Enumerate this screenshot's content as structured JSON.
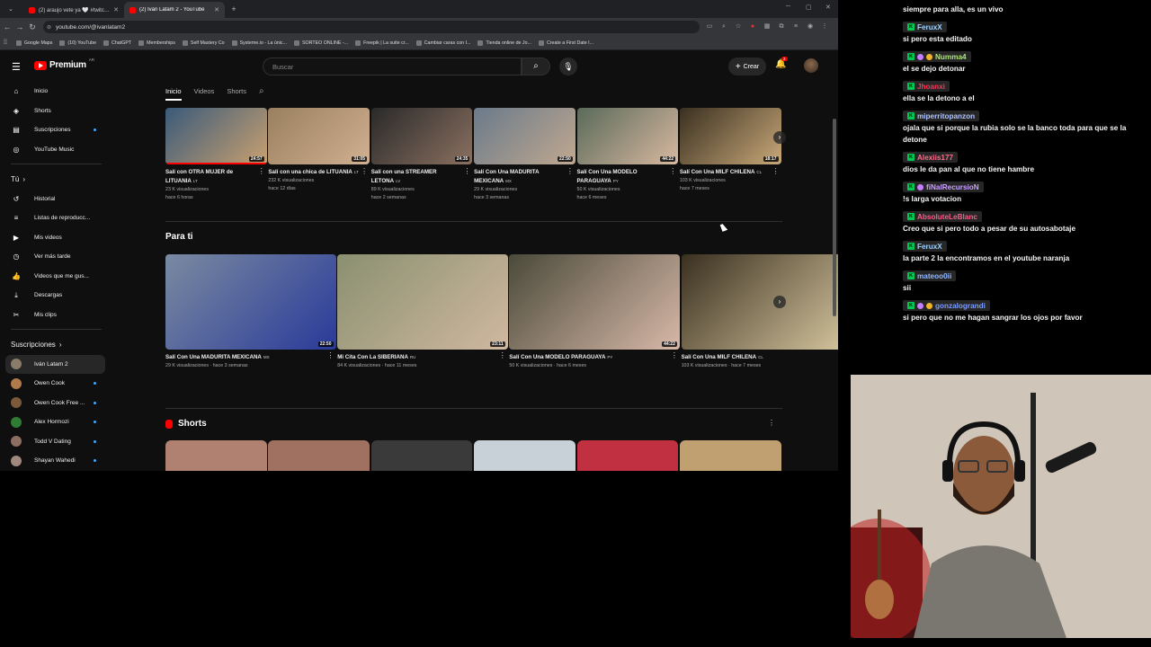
{
  "browser": {
    "tabs": [
      {
        "label": "(2) araujo vete ya 🤍 #twitch 🤍 "
      },
      {
        "label": "(2) Iván Latam 2 - YouTube"
      }
    ],
    "url": "youtube.com/@ivanlatam2",
    "bookmarks": [
      "Google Maps",
      "(10) YouTube",
      "ChatGPT",
      "Memberships",
      "Self Mastery Co",
      "Systeme.io - La únic...",
      "SORTEO ONLINE -...",
      "Freepik | La suite cr...",
      "Cambiar caras con I...",
      "Tienda online de Jo...",
      "Create a First Date I..."
    ]
  },
  "header": {
    "logo": "Premium",
    "region": "AR",
    "search_placeholder": "Buscar",
    "create_label": "Crear",
    "notifications": "2"
  },
  "sidebar": {
    "main": [
      {
        "label": "Inicio",
        "icon": "home-icon"
      },
      {
        "label": "Shorts",
        "icon": "shorts-icon"
      },
      {
        "label": "Suscripciones",
        "icon": "subscriptions-icon"
      },
      {
        "label": "YouTube Music",
        "icon": "music-icon"
      }
    ],
    "you_header": "Tú",
    "you": [
      {
        "label": "Historial",
        "icon": "history-icon"
      },
      {
        "label": "Listas de reproducc...",
        "icon": "playlist-icon"
      },
      {
        "label": "Mis videos",
        "icon": "video-icon"
      },
      {
        "label": "Ver más tarde",
        "icon": "clock-icon"
      },
      {
        "label": "Videos que me gus...",
        "icon": "like-icon"
      },
      {
        "label": "Descargas",
        "icon": "download-icon"
      },
      {
        "label": "Mis clips",
        "icon": "scissors-icon"
      }
    ],
    "subs_header": "Suscripciones",
    "subs": [
      {
        "label": "Iván Latam 2",
        "color": "#8a7b6a"
      },
      {
        "label": "Owen Cook",
        "color": "#b07a4a"
      },
      {
        "label": "Owen Cook Free ...",
        "color": "#7a5a3a"
      },
      {
        "label": "Alex Hormozi",
        "color": "#2e7d32"
      },
      {
        "label": "Todd V Dating",
        "color": "#8d6e63"
      },
      {
        "label": "Shayan Wahedi",
        "color": "#a1887f"
      }
    ]
  },
  "channel_tabs": [
    "Inicio",
    "Videos",
    "Shorts"
  ],
  "row1": [
    {
      "title": "Salí con OTRA MUJER de LITUANIA",
      "flag": "LT",
      "views": "23 K visualizaciones",
      "age": "hace 6 horas",
      "dur": "24:57",
      "c1": "#3a5a7a",
      "c2": "#c8a070"
    },
    {
      "title": "Salí con una chica de LITUANIA",
      "flag": "LT",
      "views": "232 K visualizaciones",
      "age": "hace 12 días",
      "dur": "31:05",
      "c1": "#9a8060",
      "c2": "#d0b090"
    },
    {
      "title": "Salí con una STREAMER LETONA",
      "flag": "LV",
      "views": "89 K visualizaciones",
      "age": "hace 2 semanas",
      "dur": "24:35",
      "c1": "#2a2a2a",
      "c2": "#8a7060"
    },
    {
      "title": "Salí Con Una MADURITA MEXICANA",
      "flag": "MX",
      "views": "29 K visualizaciones",
      "age": "hace 3 semanas",
      "dur": "22:50",
      "c1": "#6a7a8a",
      "c2": "#c0a890"
    },
    {
      "title": "Salí Con Una MODELO PARAGUAYA",
      "flag": "PY",
      "views": "50 K visualizaciones",
      "age": "hace 6 meses",
      "dur": "44:22",
      "c1": "#5a6a5a",
      "c2": "#d8b8a0"
    },
    {
      "title": "Salí Con Una MILF CHILENA",
      "flag": "CL",
      "views": "103 K visualizaciones",
      "age": "hace 7 meses",
      "dur": "18:17",
      "c1": "#3a3020",
      "c2": "#c8a878"
    }
  ],
  "section_para_ti": "Para ti",
  "row2": [
    {
      "title": "Salí Con Una MADURITA MEXICANA",
      "flag": "MX",
      "meta": "29 K visualizaciones · hace 3 semanas",
      "dur": "22:50",
      "c1": "#7a8aa0",
      "c2": "#2a3a9a"
    },
    {
      "title": "Mi Cita Con La SIBERIANA",
      "flag": "RU",
      "meta": "84 K visualizaciones · hace 11 meses",
      "dur": "23:11",
      "c1": "#8a9070",
      "c2": "#d0b8a0"
    },
    {
      "title": "Salí Con Una MODELO PARAGUAYA",
      "flag": "PY",
      "meta": "50 K visualizaciones · hace 6 meses",
      "dur": "44:22",
      "c1": "#4a4a3a",
      "c2": "#d8b8a8"
    },
    {
      "title": "Salí Con Una MILF CHILENA",
      "flag": "CL",
      "meta": "103 K visualizaciones · hace 7 meses",
      "dur": "",
      "c1": "#3a3020",
      "c2": "#d8c8a0"
    }
  ],
  "section_shorts": "Shorts",
  "shorts": [
    {
      "c": "#b08070"
    },
    {
      "c": "#a07060"
    },
    {
      "c": "#3a3a3a"
    },
    {
      "c": "#c8d0d8"
    },
    {
      "c": "#c03040"
    },
    {
      "c": "#c0a070"
    }
  ],
  "chat": [
    {
      "text": "siempre para alla, es un vivo"
    },
    {
      "user": "FeruxX",
      "color": "#9ad0ff",
      "text": "si pero esta editado"
    },
    {
      "user": "Numma4",
      "color": "#b0e57c",
      "text": "el se dejo detonar"
    },
    {
      "user": "Jhoanxi",
      "color": "#ff3355",
      "text": "ella se la detono a el"
    },
    {
      "user": "miperritopanzon",
      "color": "#b0c4ff",
      "text": "ojala que si porque la rubia solo se la banco toda para que se la detone"
    },
    {
      "user": "Alexiis177",
      "color": "#ff6b8a",
      "text": "dios le da pan al que no tiene hambre"
    },
    {
      "user": "fiNalRecursioN",
      "color": "#c9a0ff",
      "text": "!s larga votacion"
    },
    {
      "user": "AbsoluteLeBlanc",
      "color": "#ff5c8a",
      "text": "Creo que si pero todo a pesar de su autosabotaje"
    },
    {
      "user": "FeruxX",
      "color": "#9ad0ff",
      "text": "la parte 2 la encontramos en el youtube naranja"
    },
    {
      "user": "mateoo0ii",
      "color": "#8fb8ff",
      "text": "sii"
    },
    {
      "user": "gonzalograndi",
      "color": "#7a9cff",
      "text": "si pero que no me hagan sangrar los ojos por favor"
    }
  ]
}
